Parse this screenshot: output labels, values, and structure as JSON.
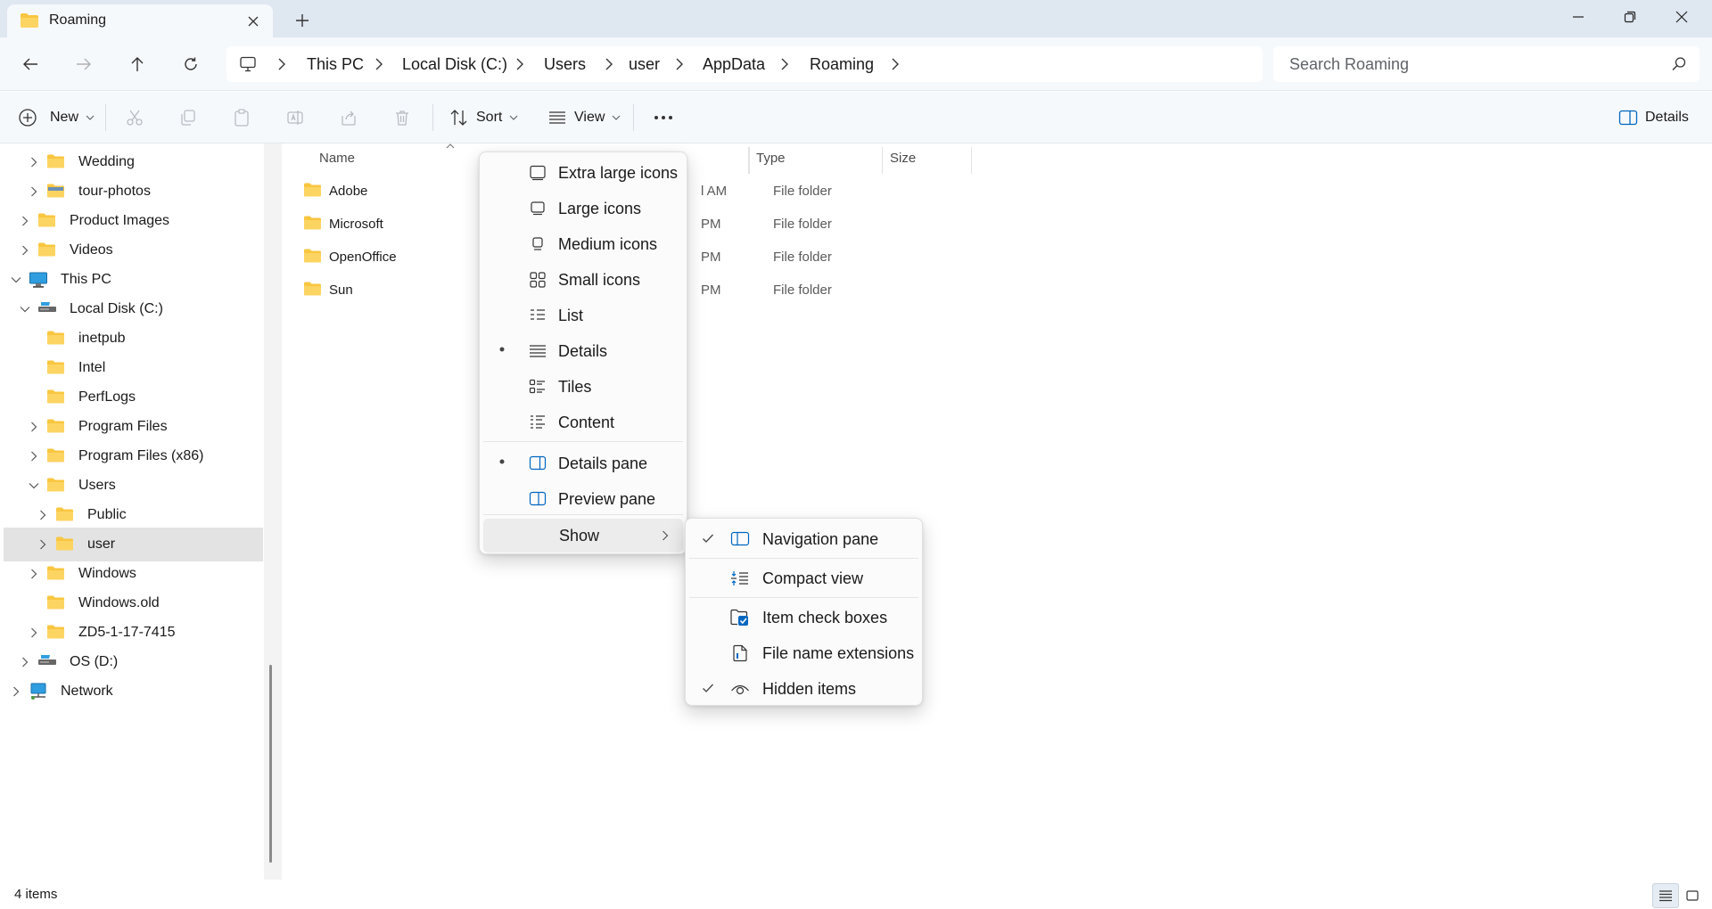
{
  "window": {
    "tab_title": "Roaming",
    "colors": {
      "titlebar": "#dfe7f1",
      "accent": "#0067c0",
      "folder": "#f8c640"
    }
  },
  "address": {
    "breadcrumbs": [
      "This PC",
      "Local Disk (C:)",
      "Users",
      "user",
      "AppData",
      "Roaming"
    ],
    "search_placeholder": "Search Roaming"
  },
  "commandbar": {
    "new_label": "New",
    "sort_label": "Sort",
    "view_label": "View",
    "details_label": "Details"
  },
  "sidebar": {
    "items": [
      {
        "label": "Wedding",
        "expander": "collapsed",
        "icon": "folder-icon"
      },
      {
        "label": "tour-photos",
        "expander": "collapsed",
        "icon": "folder-image-icon"
      },
      {
        "label": "Product Images",
        "expander": "collapsed",
        "icon": "folder-icon"
      },
      {
        "label": "Videos",
        "expander": "collapsed",
        "icon": "folder-icon"
      },
      {
        "label": "This PC",
        "expander": "expanded",
        "icon": "pc-icon"
      },
      {
        "label": "Local Disk (C:)",
        "expander": "expanded",
        "icon": "drive-icon"
      },
      {
        "label": "inetpub",
        "expander": "none",
        "icon": "folder-icon"
      },
      {
        "label": "Intel",
        "expander": "none",
        "icon": "folder-icon"
      },
      {
        "label": "PerfLogs",
        "expander": "none",
        "icon": "folder-icon"
      },
      {
        "label": "Program Files",
        "expander": "collapsed",
        "icon": "folder-icon"
      },
      {
        "label": "Program Files (x86)",
        "expander": "collapsed",
        "icon": "folder-icon"
      },
      {
        "label": "Users",
        "expander": "expanded",
        "icon": "folder-icon"
      },
      {
        "label": "Public",
        "expander": "collapsed",
        "icon": "folder-icon"
      },
      {
        "label": "user",
        "expander": "collapsed",
        "icon": "folder-icon",
        "selected": true
      },
      {
        "label": "Windows",
        "expander": "collapsed",
        "icon": "folder-icon"
      },
      {
        "label": "Windows.old",
        "expander": "none",
        "icon": "folder-icon"
      },
      {
        "label": "ZD5-1-17-7415",
        "expander": "collapsed",
        "icon": "folder-icon"
      },
      {
        "label": "OS (D:)",
        "expander": "collapsed",
        "icon": "drive-icon"
      },
      {
        "label": "Network",
        "expander": "collapsed",
        "icon": "network-icon"
      }
    ]
  },
  "filelist": {
    "columns": {
      "name": "Name",
      "type": "Type",
      "size": "Size"
    },
    "rows": [
      {
        "name": "Adobe",
        "date_fragment": "l AM",
        "type": "File folder"
      },
      {
        "name": "Microsoft",
        "date_fragment": "PM",
        "type": "File folder"
      },
      {
        "name": "OpenOffice",
        "date_fragment": "PM",
        "type": "File folder"
      },
      {
        "name": "Sun",
        "date_fragment": "PM",
        "type": "File folder"
      }
    ]
  },
  "view_menu": {
    "items": [
      {
        "label": "Extra large icons",
        "icon": "extra-large-icons-icon",
        "selected": false
      },
      {
        "label": "Large icons",
        "icon": "large-icons-icon",
        "selected": false
      },
      {
        "label": "Medium icons",
        "icon": "medium-icons-icon",
        "selected": false
      },
      {
        "label": "Small icons",
        "icon": "small-icons-icon",
        "selected": false
      },
      {
        "label": "List",
        "icon": "list-icon",
        "selected": false
      },
      {
        "label": "Details",
        "icon": "details-icon",
        "selected": true
      },
      {
        "label": "Tiles",
        "icon": "tiles-icon",
        "selected": false
      },
      {
        "label": "Content",
        "icon": "content-icon",
        "selected": false
      }
    ],
    "panes": [
      {
        "label": "Details pane",
        "icon": "details-pane-icon",
        "selected": true
      },
      {
        "label": "Preview pane",
        "icon": "preview-pane-icon",
        "selected": false
      }
    ],
    "show_label": "Show"
  },
  "show_submenu": {
    "items": [
      {
        "label": "Navigation pane",
        "icon": "navigation-pane-icon",
        "checked": true
      },
      {
        "label": "Compact view",
        "icon": "compact-view-icon",
        "checked": false
      },
      {
        "label": "Item check boxes",
        "icon": "item-check-boxes-icon",
        "checked": false
      },
      {
        "label": "File name extensions",
        "icon": "file-name-extensions-icon",
        "checked": false
      },
      {
        "label": "Hidden items",
        "icon": "hidden-items-icon",
        "checked": true
      }
    ]
  },
  "statusbar": {
    "item_count": "4 items"
  }
}
